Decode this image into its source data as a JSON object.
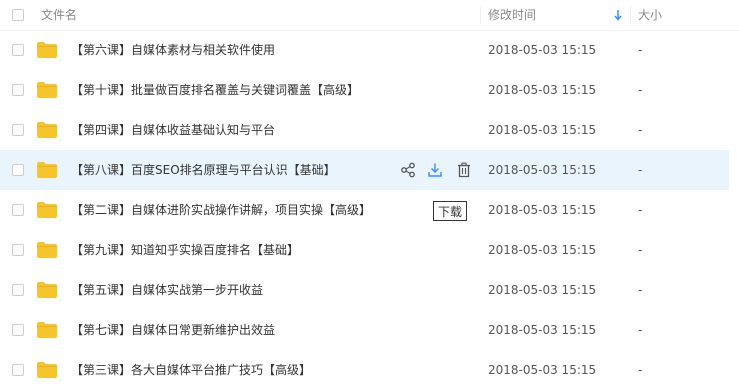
{
  "header": {
    "name_label": "文件名",
    "time_label": "修改时间",
    "size_label": "大小",
    "sort_icon": "arrow-down-icon"
  },
  "files": [
    {
      "name": "【第六课】自媒体素材与相关软件使用",
      "modified": "2018-05-03 15:15",
      "size": "-"
    },
    {
      "name": "【第十课】批量做百度排名覆盖与关键词覆盖【高级】",
      "modified": "2018-05-03 15:15",
      "size": "-"
    },
    {
      "name": "【第四课】自媒体收益基础认知与平台",
      "modified": "2018-05-03 15:15",
      "size": "-"
    },
    {
      "name": "【第八课】百度SEO排名原理与平台认识【基础】",
      "modified": "2018-05-03 15:15",
      "size": "-"
    },
    {
      "name": "【第二课】自媒体进阶实战操作讲解，项目实操【高级】",
      "modified": "2018-05-03 15:15",
      "size": "-"
    },
    {
      "name": "【第九课】知道知乎实操百度排名【基础】",
      "modified": "2018-05-03 15:15",
      "size": "-"
    },
    {
      "name": "【第五课】自媒体实战第一步开收益",
      "modified": "2018-05-03 15:15",
      "size": "-"
    },
    {
      "name": "【第七课】自媒体日常更新维护出效益",
      "modified": "2018-05-03 15:15",
      "size": "-"
    },
    {
      "name": "【第三课】各大自媒体平台推广技巧【高级】",
      "modified": "2018-05-03 15:15",
      "size": "-"
    }
  ],
  "hover_actions": {
    "row_index": 3,
    "share_icon": "share-icon",
    "download_icon": "download-icon",
    "delete_icon": "trash-icon"
  },
  "tooltip": {
    "text": "下载"
  },
  "colors": {
    "folder": "#f6c42c",
    "hover_row": "#e9f4fc",
    "accent": "#3b8cff"
  }
}
